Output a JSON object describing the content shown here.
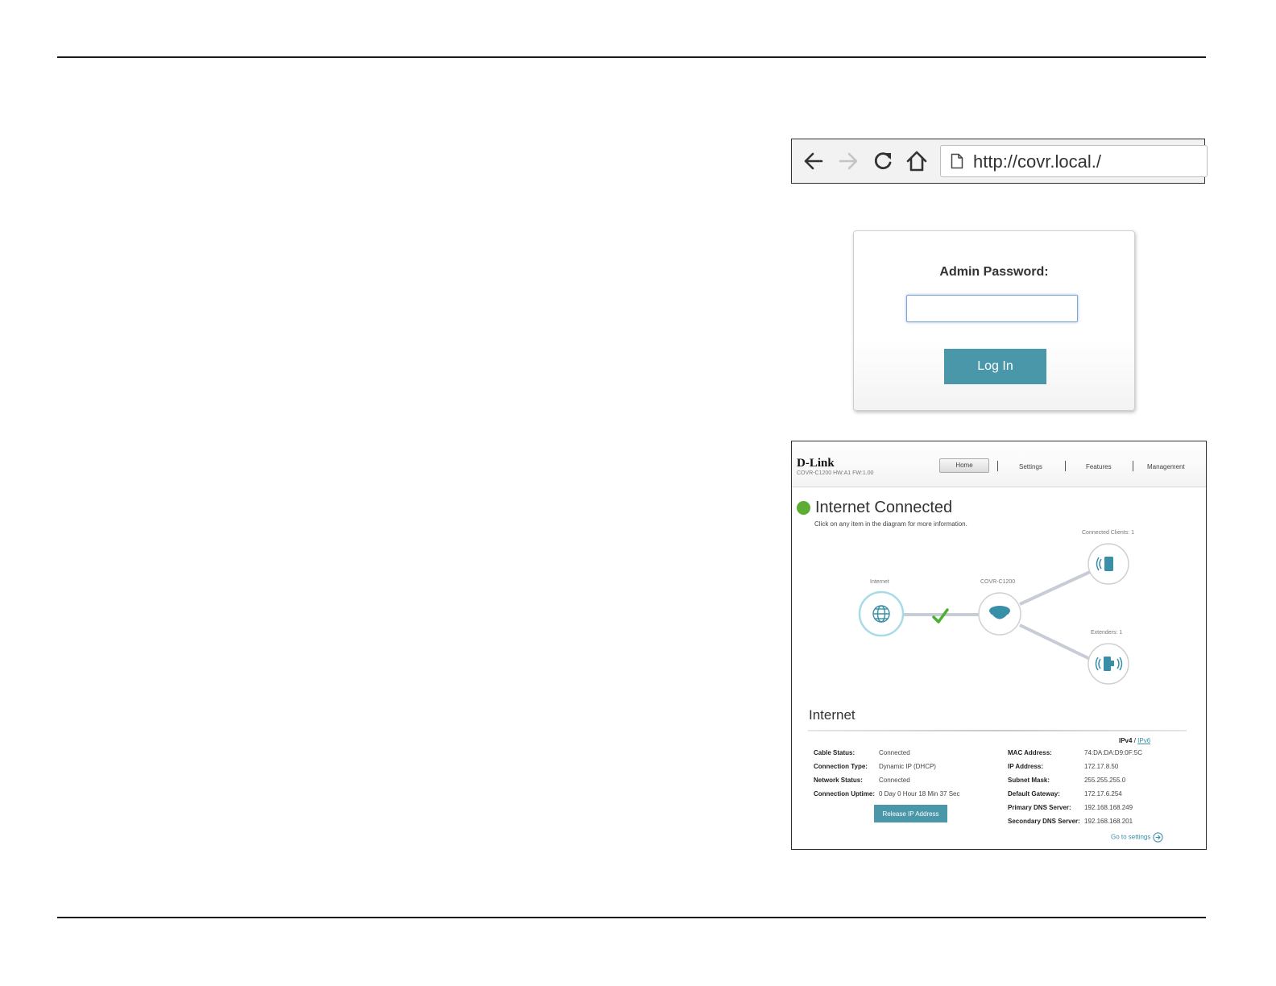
{
  "browser": {
    "url": "http://covr.local./"
  },
  "login": {
    "label": "Admin Password:",
    "password_value": "",
    "button_label": "Log In"
  },
  "dashboard": {
    "brand": "D-Link",
    "model_info": "COVR-C1200 HW:A1 FW:1.00",
    "nav": {
      "home": "Home",
      "settings": "Settings",
      "features": "Features",
      "management": "Management"
    },
    "status": {
      "title": "Internet Connected",
      "hint": "Click on any item in the diagram for more information.",
      "color": "#5cad33"
    },
    "diagram": {
      "internet_label": "Internet",
      "router_label": "COVR-C1200",
      "clients_label": "Connected Clients: 1",
      "extenders_label": "Extenders: 1"
    },
    "internet_section": {
      "title": "Internet",
      "tab_ipv4": "IPv4",
      "tab_sep": "/",
      "tab_ipv6": "IPv6",
      "left": [
        {
          "key": "Cable Status:",
          "value": "Connected"
        },
        {
          "key": "Connection Type:",
          "value": "Dynamic IP (DHCP)"
        },
        {
          "key": "Network Status:",
          "value": "Connected"
        },
        {
          "key": "Connection Uptime:",
          "value": "0 Day 0 Hour 18 Min 37 Sec"
        }
      ],
      "right": [
        {
          "key": "MAC Address:",
          "value": "74:DA:DA:D9:0F:5C"
        },
        {
          "key": "IP Address:",
          "value": "172.17.8.50"
        },
        {
          "key": "Subnet Mask:",
          "value": "255.255.255.0"
        },
        {
          "key": "Default Gateway:",
          "value": "172.17.6.254"
        },
        {
          "key": "Primary DNS Server:",
          "value": "192.168.168.249"
        },
        {
          "key": "Secondary DNS Server:",
          "value": "192.168.168.201"
        }
      ],
      "release_button": "Release IP Address",
      "go_to_settings": "Go to settings"
    },
    "accent_color": "#4a97aa"
  }
}
